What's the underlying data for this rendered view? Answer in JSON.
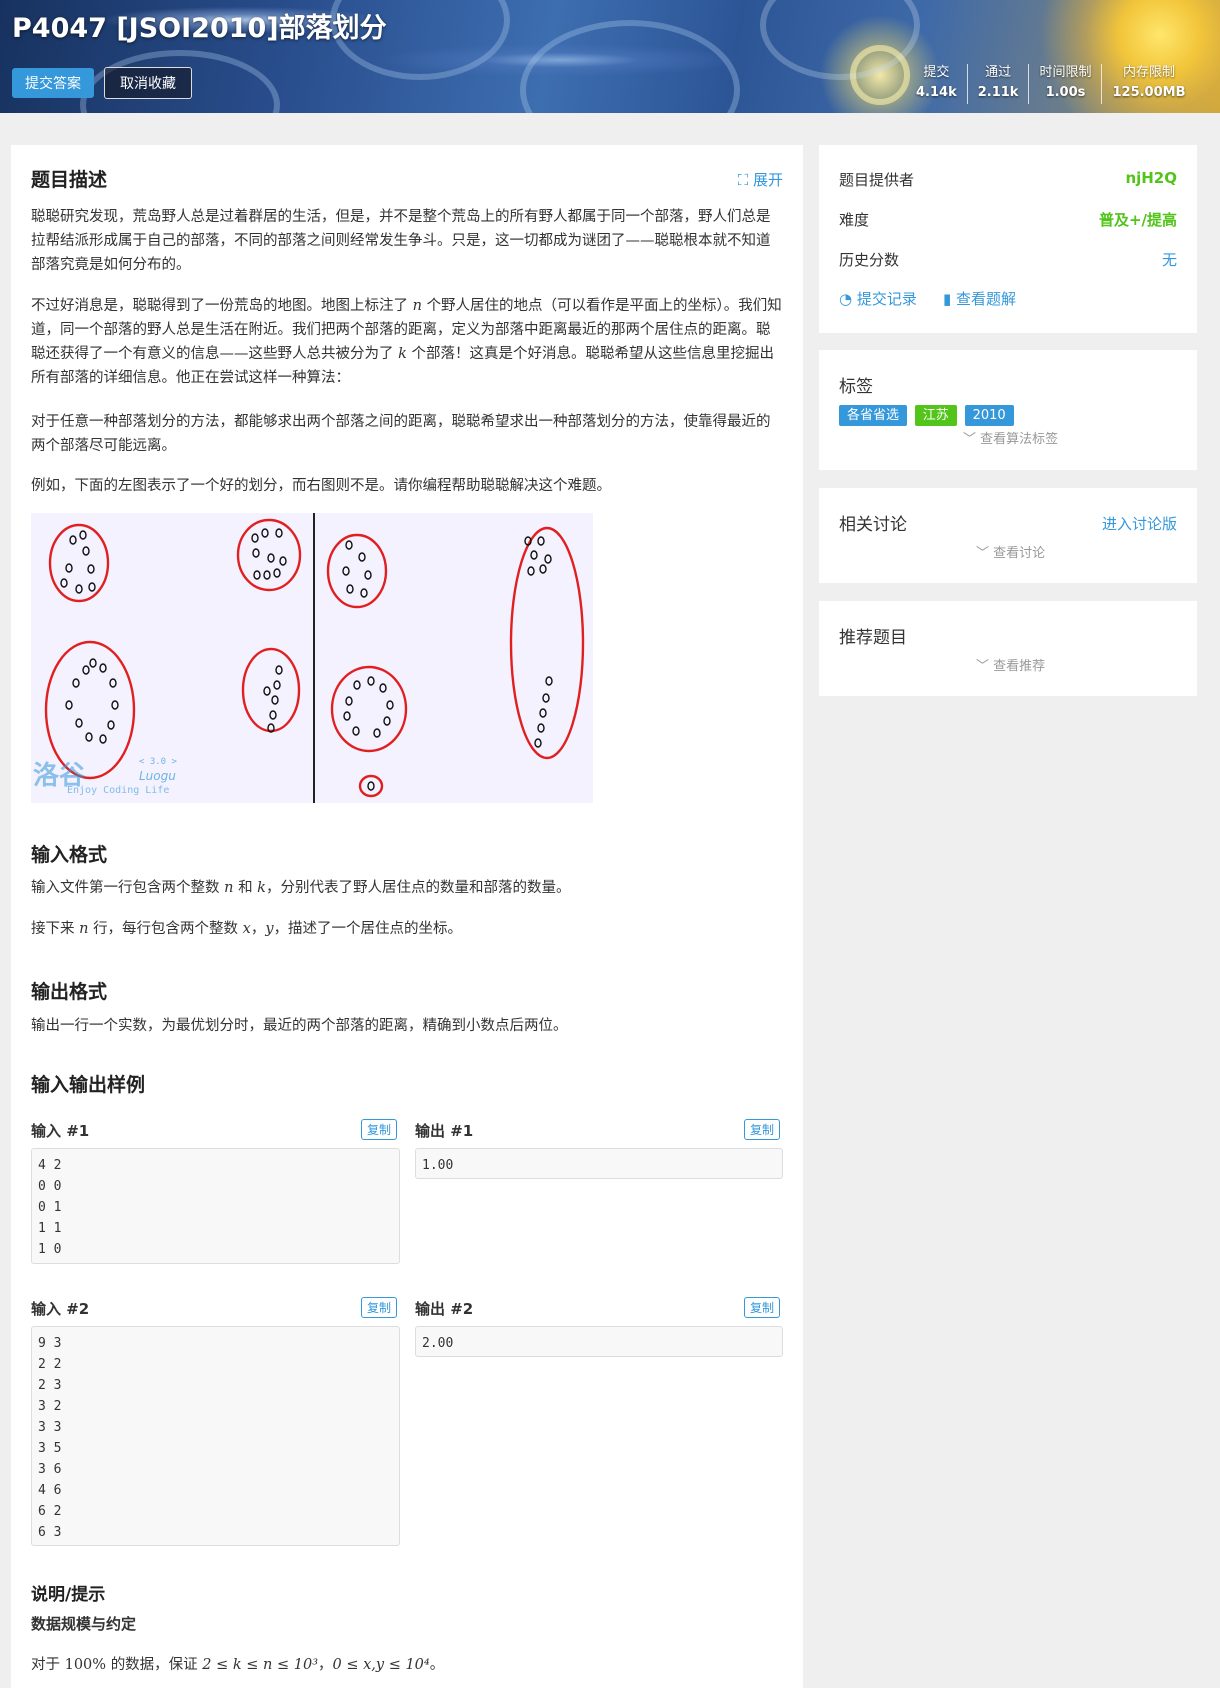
{
  "header": {
    "title": "P4047 [JSOI2010]部落划分",
    "submit_label": "提交答案",
    "unfavorite_label": "取消收藏",
    "stats": [
      {
        "label": "提交",
        "value": "4.14k"
      },
      {
        "label": "通过",
        "value": "2.11k"
      },
      {
        "label": "时间限制",
        "value": "1.00s"
      },
      {
        "label": "内存限制",
        "value": "125.00MB"
      }
    ]
  },
  "problem": {
    "desc_title": "题目描述",
    "expand_label": "展开",
    "p1": "聪聪研究发现，荒岛野人总是过着群居的生活，但是，并不是整个荒岛上的所有野人都属于同一个部落，野人们总是拉帮结派形成属于自己的部落，不同的部落之间则经常发生争斗。只是，这一切都成为谜团了——聪聪根本就不知道部落究竟是如何分布的。",
    "p2_a": "不过好消息是，聪聪得到了一份荒岛的地图。地图上标注了",
    "p2_n": "n",
    "p2_b": "个野人居住的地点（可以看作是平面上的坐标）。我们知道，同一个部落的野人总是生活在附近。我们把两个部落的距离，定义为部落中距离最近的那两个居住点的距离。聪聪还获得了一个有意义的信息——这些野人总共被分为了",
    "p2_k": "k",
    "p2_c": "个部落！这真是个好消息。聪聪希望从这些信息里挖掘出所有部落的详细信息。他正在尝试这样一种算法：",
    "p3": "对于任意一种部落划分的方法，都能够求出两个部落之间的距离，聪聪希望求出一种部落划分的方法，使靠得最近的两个部落尽可能远离。",
    "p4": "例如，下面的左图表示了一个好的划分，而右图则不是。请你编程帮助聪聪解决这个难题。",
    "watermark_cn": "洛谷",
    "watermark_ver": "< 3.0 >",
    "watermark_en": "Luogu",
    "watermark_slogan": "Enjoy Coding Life",
    "input_title": "输入格式",
    "input_p1_a": "输入文件第一行包含两个整数",
    "input_p1_n": "n",
    "input_p1_and": "和",
    "input_p1_k": "k",
    "input_p1_b": "，分别代表了野人居住点的数量和部落的数量。",
    "input_p2_a": "接下来",
    "input_p2_n": "n",
    "input_p2_b": "行，每行包含两个整数",
    "input_p2_x": "x",
    "input_p2_sep": "，",
    "input_p2_y": "y",
    "input_p2_c": "，描述了一个居住点的坐标。",
    "output_title": "输出格式",
    "output_p": "输出一行一个实数，为最优划分时，最近的两个部落的距离，精确到小数点后两位。",
    "samples_title": "输入输出样例",
    "copy_label": "复制",
    "samples": [
      {
        "in_label": "输入 #1",
        "out_label": "输出 #1",
        "input": "4 2\n0 0\n0 1\n1 1\n1 0",
        "output": "1.00"
      },
      {
        "in_label": "输入 #2",
        "out_label": "输出 #2",
        "input": "9 3\n2 2\n2 3\n3 2\n3 3\n3 5\n3 6\n4 6\n6 2\n6 3",
        "output": "2.00"
      }
    ],
    "hint_title": "说明/提示",
    "hint_sub": "数据规模与约定",
    "hint_a": "对于",
    "hint_pct": "100%",
    "hint_b": "的数据，保证",
    "hint_c1": "2 ≤ k ≤ n ≤ 10³",
    "hint_sep": "，",
    "hint_c2": "0 ≤ x,y ≤ 10⁴",
    "hint_end": "。"
  },
  "sidebar": {
    "provider_label": "题目提供者",
    "provider_value": "njH2Q",
    "difficulty_label": "难度",
    "difficulty_value": "普及+/提高",
    "history_label": "历史分数",
    "history_value": "无",
    "records_label": "提交记录",
    "solutions_label": "查看题解",
    "tags_title": "标签",
    "tags": [
      {
        "text": "各省省选",
        "color": "#3498db"
      },
      {
        "text": "江苏",
        "color": "#52c41a"
      },
      {
        "text": "2010",
        "color": "#3498db"
      }
    ],
    "tags_more": "查看算法标签",
    "discuss_title": "相关讨论",
    "discuss_link": "进入讨论版",
    "discuss_more": "查看讨论",
    "recommend_title": "推荐题目",
    "recommend_more": "查看推荐"
  },
  "colors": {
    "accent": "#3498db",
    "green": "#52c41a"
  }
}
